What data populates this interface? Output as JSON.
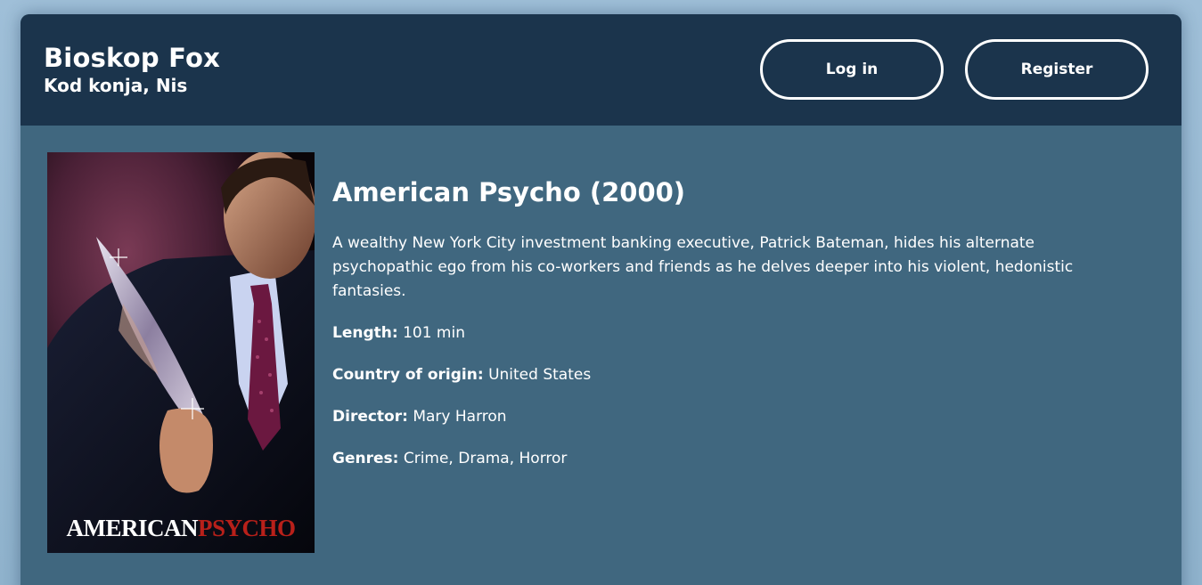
{
  "header": {
    "cinema_name": "Bioskop Fox",
    "location": "Kod konja, Nis",
    "login_label": "Log in",
    "register_label": "Register"
  },
  "movie": {
    "title": "American Psycho (2000)",
    "description": "A wealthy New York City investment banking executive, Patrick Bateman, hides his alternate psychopathic ego from his co-workers and friends as he delves deeper into his violent, hedonistic fantasies.",
    "poster": {
      "title_part1": "AMERICAN",
      "title_part2": "PSYCHO"
    },
    "details": [
      {
        "label": "Length:",
        "value": "101 min"
      },
      {
        "label": "Country of origin:",
        "value": "United States"
      },
      {
        "label": "Director:",
        "value": "Mary Harron"
      },
      {
        "label": "Genres:",
        "value": "Crime, Drama, Horror"
      }
    ]
  },
  "colors": {
    "header_bg": "#1b344c",
    "content_bg": "#40677f",
    "page_bg": "#9fbfd8",
    "poster_title_red": "#b8201a"
  }
}
